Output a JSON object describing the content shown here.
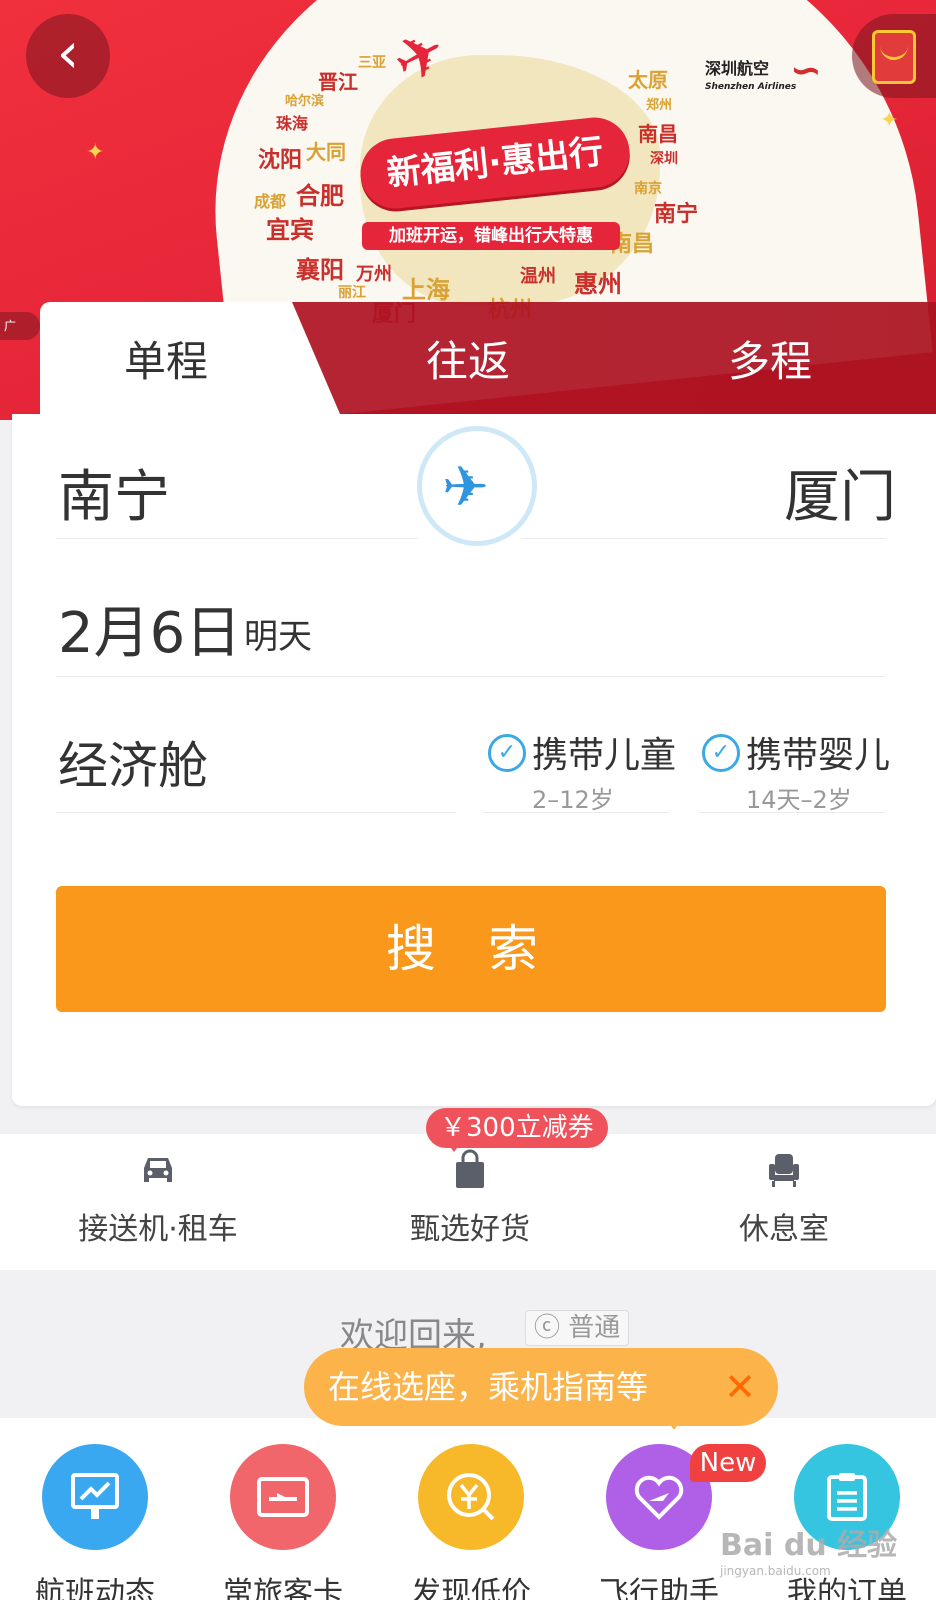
{
  "banner": {
    "cities": [
      "三亚",
      "晋江",
      "哈尔滨",
      "珠海",
      "沈阳",
      "大同",
      "成都",
      "合肥",
      "宜宾",
      "襄阳",
      "万州",
      "丽江",
      "上海",
      "厦门",
      "杭州",
      "温州",
      "惠州",
      "南昌",
      "南宁",
      "南京",
      "深圳",
      "南昌",
      "郑州",
      "太原"
    ],
    "slogan": "新福利·惠出行",
    "sub_slogan": "加班开运，错峰出行大特惠",
    "airline_cn": "深圳航空",
    "airline_en": "Shenzhen Airlines",
    "ad_tag": "广"
  },
  "tabs": [
    {
      "label": "单程"
    },
    {
      "label": "往返"
    },
    {
      "label": "多程"
    }
  ],
  "form": {
    "from_city": "南宁",
    "to_city": "厦门",
    "date": "2月6日",
    "date_hint": "明天",
    "cabin": "经济舱",
    "child": {
      "label": "携带儿童",
      "range": "2–12岁"
    },
    "infant": {
      "label": "携带婴儿",
      "range": "14天–2岁"
    },
    "search_label": "搜 索"
  },
  "services": {
    "coupon": "￥300立减券",
    "items": [
      {
        "label": "接送机·租车",
        "icon": "car-icon"
      },
      {
        "label": "甄选好货",
        "icon": "shopping-bag-icon"
      },
      {
        "label": "休息室",
        "icon": "lounge-chair-icon"
      }
    ]
  },
  "welcome": {
    "text": "欢迎回来,",
    "member_level": "普通"
  },
  "tip": {
    "text": "在线选座，乘机指南等",
    "close": "✕"
  },
  "bottom_nav": {
    "items": [
      {
        "label": "航班动态",
        "icon": "flight-status-icon",
        "color": "#3aa8f0"
      },
      {
        "label": "常旅客卡",
        "icon": "card-icon",
        "color": "#f0666a"
      },
      {
        "label": "发现低价",
        "icon": "low-price-icon",
        "color": "#f7b92a"
      },
      {
        "label": "飞行助手",
        "icon": "heart-plane-icon",
        "color": "#b060e6"
      },
      {
        "label": "我的订单",
        "icon": "order-icon",
        "color": "#35c5e0"
      }
    ],
    "new_badge": "New"
  },
  "watermark": {
    "text": "Bai du 经验",
    "sub": "jingyan.baidu.com"
  },
  "colors": {
    "brand_red": "#e8283a",
    "accent_orange": "#f9981a",
    "check_blue": "#3aa9e6"
  }
}
